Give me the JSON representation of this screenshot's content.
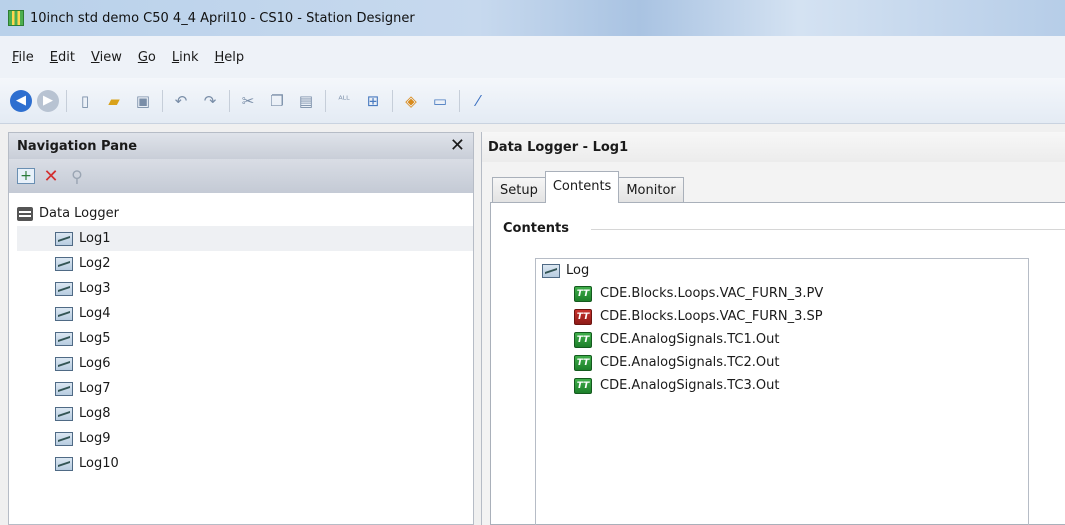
{
  "window": {
    "title": "10inch std demo C50 4_4 April10 - CS10 - Station Designer"
  },
  "menu": [
    "File",
    "Edit",
    "View",
    "Go",
    "Link",
    "Help"
  ],
  "toolbar": {
    "icons": [
      "back-icon",
      "forward-icon",
      "new-icon",
      "open-icon",
      "save-icon",
      "undo-icon",
      "redo-icon",
      "cut-icon",
      "copy-icon",
      "paste-icon",
      "find-replace-icon",
      "network-icon",
      "view-icon",
      "monitor-icon",
      "tools-icon"
    ]
  },
  "nav": {
    "title": "Navigation Pane",
    "root_label": "Data Logger",
    "items": [
      {
        "label": "Log1"
      },
      {
        "label": "Log2"
      },
      {
        "label": "Log3"
      },
      {
        "label": "Log4"
      },
      {
        "label": "Log5"
      },
      {
        "label": "Log6"
      },
      {
        "label": "Log7"
      },
      {
        "label": "Log8"
      },
      {
        "label": "Log9"
      },
      {
        "label": "Log10"
      }
    ],
    "selected": "Log1"
  },
  "editor": {
    "title": "Data Logger - Log1",
    "tabs": [
      {
        "label": "Setup"
      },
      {
        "label": "Contents"
      },
      {
        "label": "Monitor"
      }
    ],
    "active_tab": "Contents",
    "group_label": "Contents",
    "root_label": "Log",
    "entries": [
      {
        "label": "CDE.Blocks.Loops.VAC_FURN_3.PV",
        "status": "green"
      },
      {
        "label": "CDE.Blocks.Loops.VAC_FURN_3.SP",
        "status": "red"
      },
      {
        "label": "CDE.AnalogSignals.TC1.Out",
        "status": "green"
      },
      {
        "label": "CDE.AnalogSignals.TC2.Out",
        "status": "green"
      },
      {
        "label": "CDE.AnalogSignals.TC3.Out",
        "status": "green"
      }
    ],
    "tag_badge": "TT"
  },
  "colors": {
    "status_green": "#1d7f2a",
    "status_red": "#8e1b17",
    "accent": "#2e6fd0"
  }
}
